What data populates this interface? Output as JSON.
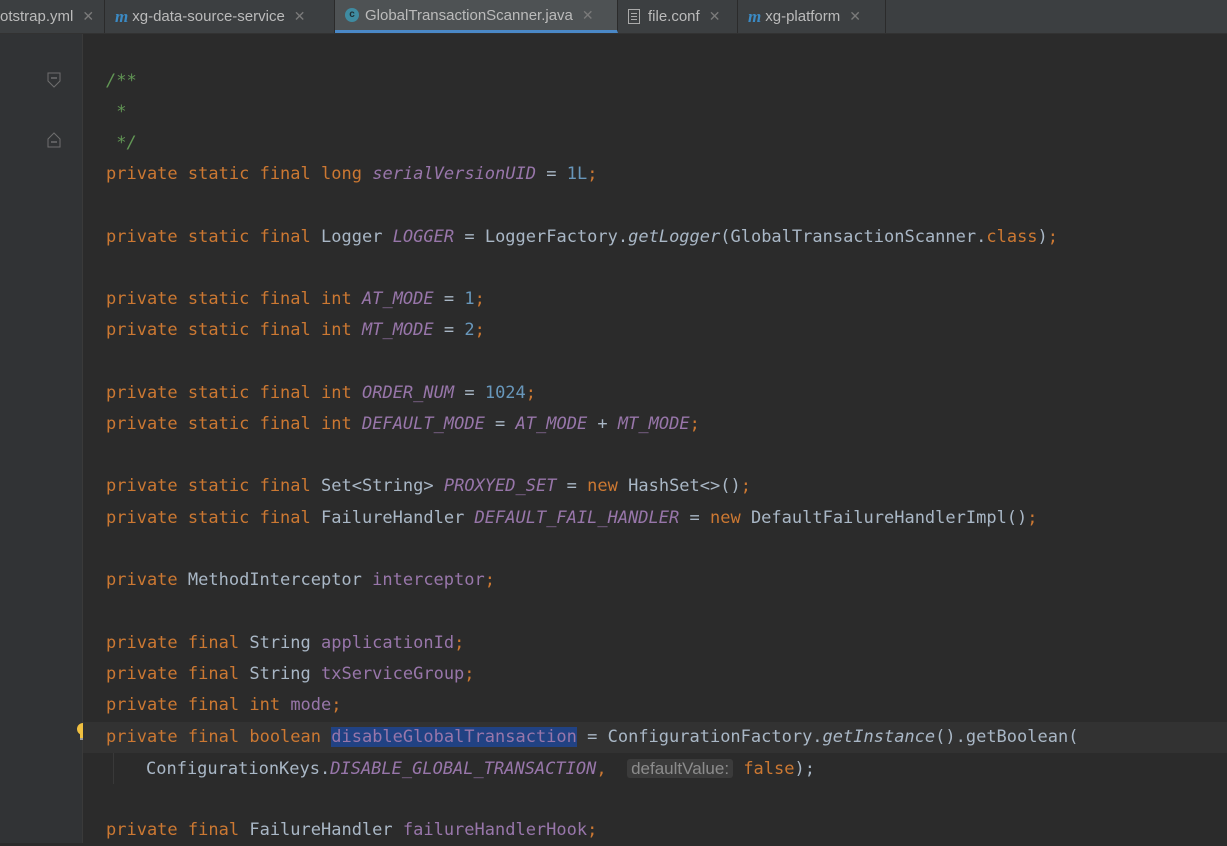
{
  "tabs": [
    {
      "label": "otstrap.yml",
      "icon": "yaml-file-icon"
    },
    {
      "label": "xg-data-source-service",
      "icon": "maven-module-icon"
    },
    {
      "label": "GlobalTransactionScanner.java",
      "icon": "java-class-icon",
      "active": true
    },
    {
      "label": "file.conf",
      "icon": "text-file-icon"
    },
    {
      "label": "xg-platform",
      "icon": "maven-module-icon"
    }
  ],
  "code": {
    "l1": "/**",
    "l2": " *",
    "l3": " */",
    "private": "private",
    "static": "static",
    "final": "final",
    "long": "long",
    "int": "int",
    "boolean": "boolean",
    "new": "new",
    "class": "class",
    "serialVersionUID": "serialVersionUID",
    "eq": " = ",
    "v1L": "1L",
    "v1": "1",
    "v2": "2",
    "v1024": "1024",
    "semi": ";",
    "Logger": "Logger",
    "LOGGER": "LOGGER",
    "LoggerFactory": "LoggerFactory.",
    "getLogger": "getLogger",
    "scannerArg": "(GlobalTransactionScanner.",
    "closeParen": ")",
    "AT_MODE": "AT_MODE",
    "MT_MODE": "MT_MODE",
    "ORDER_NUM": "ORDER_NUM",
    "DEFAULT_MODE": "DEFAULT_MODE",
    "plus": " + ",
    "SetString": "Set<String> ",
    "PROXYED_SET": "PROXYED_SET",
    "HashSet": "HashSet<>()",
    "FailureHandler": "FailureHandler ",
    "DEFAULT_FAIL_HANDLER": "DEFAULT_FAIL_HANDLER",
    "DefaultFailureHandlerImpl": "DefaultFailureHandlerImpl()",
    "MethodInterceptor": "MethodInterceptor ",
    "interceptor": "interceptor",
    "String": "String ",
    "applicationId": "applicationId",
    "txServiceGroup": "txServiceGroup",
    "mode": "mode",
    "disableGlobalTransaction": "disableGlobalTransaction",
    "ConfigurationFactory": "ConfigurationFactory.",
    "getInstance": "getInstance",
    "getBoolean": "().getBoolean(",
    "ConfigurationKeys": "ConfigurationKeys.",
    "DISABLE_GLOBAL_TRANSACTION": "DISABLE_GLOBAL_TRANSACTION",
    "comma": ",",
    "hint": "defaultValue:",
    "false": "false",
    "endCall": ");",
    "failureHandlerHook": "failureHandlerHook"
  }
}
